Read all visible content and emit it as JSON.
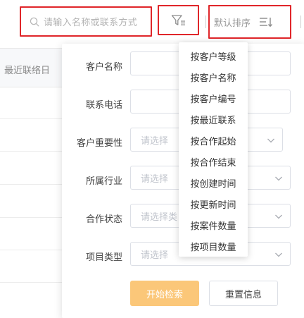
{
  "search": {
    "placeholder": "请输入名称或联系方式"
  },
  "sort": {
    "label": "默认排序"
  },
  "table": {
    "column_header": "最近联络日"
  },
  "filter_panel": {
    "fields": [
      {
        "label": "客户名称",
        "type": "text",
        "placeholder": ""
      },
      {
        "label": "联系电话",
        "type": "text",
        "placeholder": ""
      },
      {
        "label": "客户重要性",
        "type": "select",
        "placeholder": "请选择"
      },
      {
        "label": "所属行业",
        "type": "select",
        "placeholder": "请选择"
      },
      {
        "label": "合作状态",
        "type": "select",
        "placeholder": "请选择类"
      },
      {
        "label": "项目类型",
        "type": "select",
        "placeholder": "请选择"
      }
    ],
    "search_button": "开始检索",
    "reset_button": "重置信息"
  },
  "sort_menu": {
    "items": [
      "按客户等级",
      "按客户名称",
      "按客户编号",
      "按最近联系",
      "按合作起始",
      "按合作结束",
      "按创建时间",
      "按更新时间",
      "按案件数量",
      "按项目数量"
    ]
  },
  "colors": {
    "highlight_border": "#e0262a",
    "primary_button": "#fbc779",
    "placeholder_text": "#c0c4cc"
  },
  "icons": [
    "search-icon",
    "filter-icon",
    "sort-icon",
    "chevron-down-icon"
  ]
}
